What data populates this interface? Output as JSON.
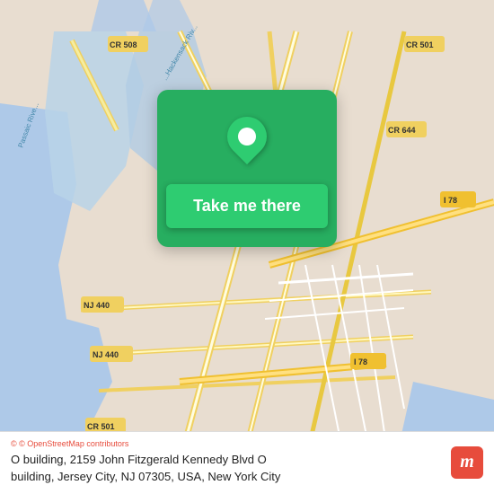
{
  "map": {
    "background_color": "#e8ddd0",
    "water_color": "#aec9e8"
  },
  "button": {
    "label": "Take me there",
    "background": "#2ecc71",
    "text_color": "#ffffff"
  },
  "info_bar": {
    "attribution": "© OpenStreetMap contributors",
    "address_line1": "O building, 2159 John Fitzgerald Kennedy Blvd O",
    "address_line2": "building, Jersey City, NJ 07305, USA, New York City"
  },
  "logo": {
    "name": "moovit",
    "letter": "m"
  },
  "roads": {
    "cr508": "CR 508",
    "cr501_top": "CR 501",
    "cr644": "CR 644",
    "i78": "I 78",
    "nj440_1": "NJ 440",
    "nj440_2": "NJ 440",
    "cr501_bottom": "CR 501",
    "i78_bottom": "I 78"
  }
}
